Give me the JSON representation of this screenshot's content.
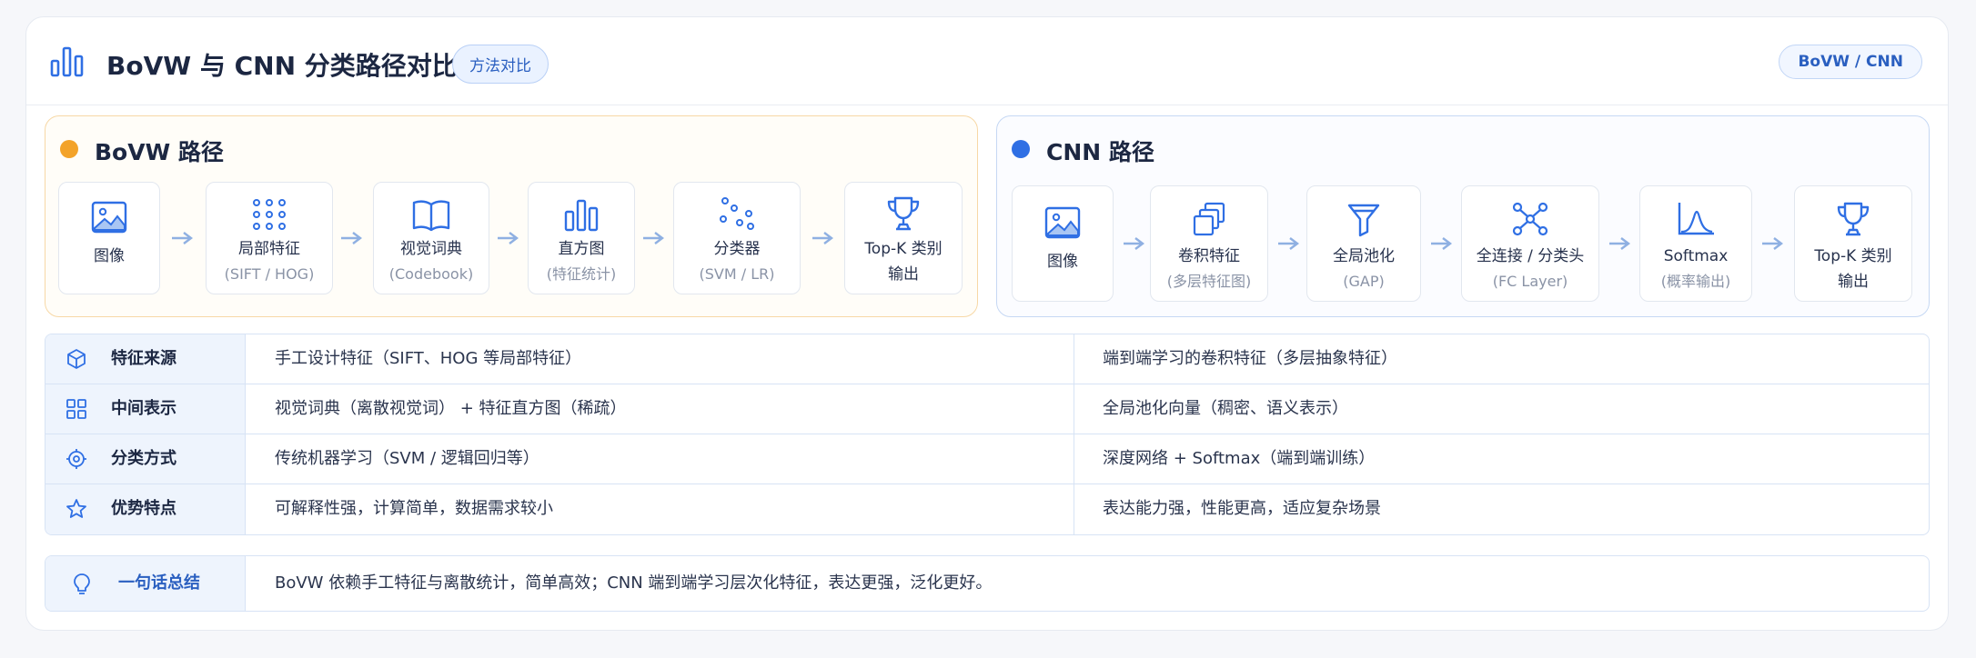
{
  "header": {
    "title": "BoVW 与 CNN 分类路径对比",
    "tag": "方法对比",
    "right_tag": "BoVW / CNN"
  },
  "bovw": {
    "title": "BoVW 路径",
    "color": "#f3a32a",
    "steps": [
      {
        "icon": "image-icon",
        "label": "图像",
        "sub": ""
      },
      {
        "icon": "grid-dots-icon",
        "label": "局部特征",
        "sub": "(SIFT / HOG)"
      },
      {
        "icon": "book-icon",
        "label": "视觉词典",
        "sub": "(Codebook)"
      },
      {
        "icon": "histogram-icon",
        "label": "直方图",
        "sub": "(特征统计)"
      },
      {
        "icon": "scatter-icon",
        "label": "分类器",
        "sub": "(SVM / LR)"
      },
      {
        "icon": "trophy-icon",
        "label": "Top-K 类别",
        "sub": "输出"
      }
    ]
  },
  "cnn": {
    "title": "CNN 路径",
    "color": "#2f6fe4",
    "steps": [
      {
        "icon": "image-icon",
        "label": "图像",
        "sub": ""
      },
      {
        "icon": "layers-icon",
        "label": "卷积特征",
        "sub": "(多层特征图)"
      },
      {
        "icon": "funnel-icon",
        "label": "全局池化",
        "sub": "(GAP)"
      },
      {
        "icon": "network-icon",
        "label": "全连接 / 分类头",
        "sub": "(FC Layer)"
      },
      {
        "icon": "distribution-icon",
        "label": "Softmax",
        "sub": "(概率输出)"
      },
      {
        "icon": "trophy-icon",
        "label": "Top-K 类别",
        "sub": "输出"
      }
    ]
  },
  "comparison": [
    {
      "icon": "cube-icon",
      "label": "特征来源",
      "bovw": "手工设计特征（SIFT、HOG 等局部特征）",
      "cnn": "端到端学习的卷积特征（多层抽象特征）"
    },
    {
      "icon": "grid-icon",
      "label": "中间表示",
      "bovw": "视觉词典（离散视觉词） + 特征直方图（稀疏）",
      "cnn": "全局池化向量（稠密、语义表示）"
    },
    {
      "icon": "target-icon",
      "label": "分类方式",
      "bovw": "传统机器学习（SVM / 逻辑回归等）",
      "cnn": "深度网络 + Softmax（端到端训练）"
    },
    {
      "icon": "star-icon",
      "label": "优势特点",
      "bovw": "可解释性强，计算简单，数据需求较小",
      "cnn": "表达能力强，性能更高，适应复杂场景"
    }
  ],
  "summary": {
    "icon": "lightbulb-icon",
    "label": "一句话总结",
    "text": "BoVW 依赖手工特征与离散统计，简单高效；CNN 端到端学习层次化特征，表达更强，泛化更好。"
  }
}
